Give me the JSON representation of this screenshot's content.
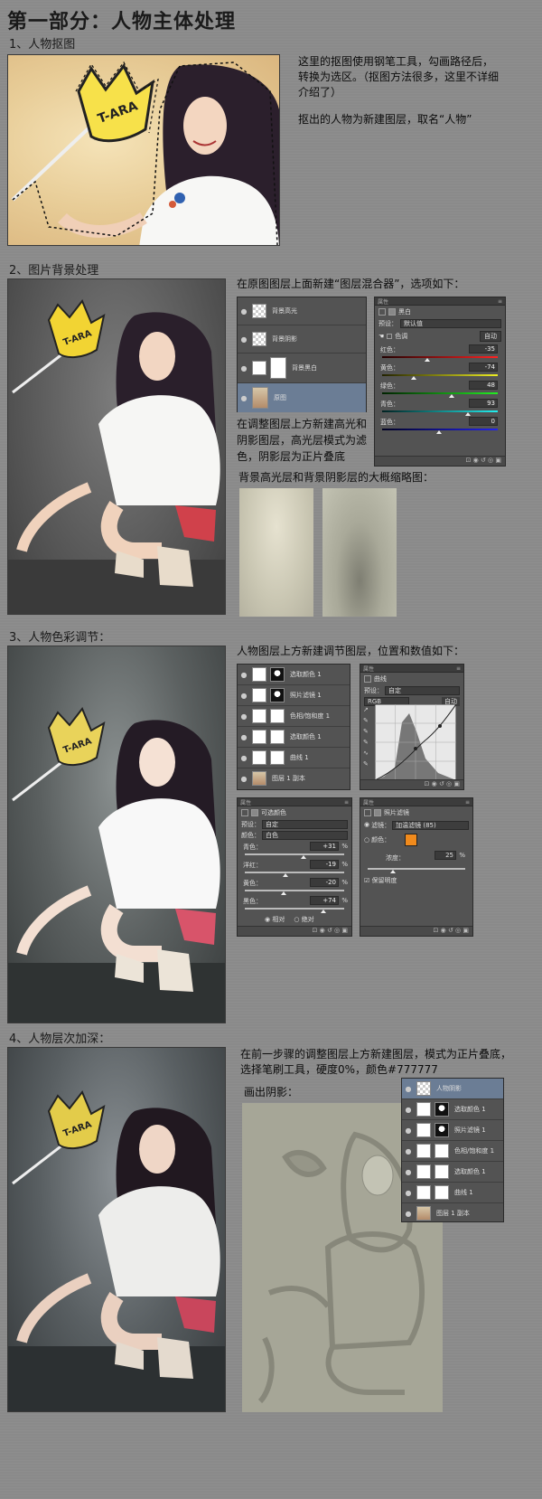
{
  "title": "第一部分：人物主体处理",
  "step1": {
    "heading": "1、人物抠图",
    "text1": "这里的抠图使用钢笔工具，勾画路径后，转换为选区。（抠图方法很多，这里不详细介绍了）",
    "text2": "抠出的人物为新建图层，取名“人物”",
    "sign_text": "T-ARA"
  },
  "step2": {
    "heading": "2、图片背景处理",
    "intro": "在原图图层上面新建“图层混合器”，选项如下：",
    "layers": [
      "背景高光",
      "背景阴影",
      "背景黑白",
      "原图"
    ],
    "adj_title": "黑白",
    "preset_label": "预设：",
    "preset_value": "默认值",
    "tint_label": "色调",
    "auto_label": "自动",
    "sliders": [
      {
        "label": "红色：",
        "value": "-35"
      },
      {
        "label": "黄色：",
        "value": "-74"
      },
      {
        "label": "绿色：",
        "value": "48"
      },
      {
        "label": "青色：",
        "value": "93"
      },
      {
        "label": "蓝色：",
        "value": "0"
      }
    ],
    "note": "在调整图层上方新建高光和阴影图层，高光层模式为滤色，阴影层为正片叠底",
    "thumb_caption": "背景高光层和背景阴影层的大概缩略图：",
    "sign_text": "T-ARA"
  },
  "step3": {
    "heading": "3、人物色彩调节：",
    "intro": "人物图层上方新建调节图层，位置和数值如下：",
    "layers": [
      "选取颜色 1",
      "照片滤镜 1",
      "色相/饱和度 1",
      "选取颜色 1",
      "曲线 1",
      "图层 1 副本"
    ],
    "curves_title": "曲线",
    "curves_preset_label": "预设：",
    "curves_preset_value": "自定",
    "curves_channel": "RGB",
    "curves_auto": "自动",
    "sc_title": "可选颜色",
    "sc_preset_label": "预设：",
    "sc_preset_value": "自定",
    "sc_color_label": "颜色：",
    "sc_color_value": "白色",
    "sc_sliders": [
      {
        "label": "青色：",
        "value": "+31",
        "unit": "%"
      },
      {
        "label": "洋红：",
        "value": "-19",
        "unit": "%"
      },
      {
        "label": "黄色：",
        "value": "-20",
        "unit": "%"
      },
      {
        "label": "黑色：",
        "value": "+74",
        "unit": "%"
      }
    ],
    "sc_radio1": "相对",
    "sc_radio2": "绝对",
    "pf_title": "照片滤镜",
    "pf_filter_label": "滤镜：",
    "pf_filter_value": "加温滤镜 (85)",
    "pf_color_label": "颜色：",
    "pf_density_label": "浓度：",
    "pf_density_value": "25",
    "pf_density_unit": "%",
    "pf_preserve": "保留明度",
    "pf_color": "#f08a1c",
    "sign_text": "T-ARA"
  },
  "step4": {
    "heading": "4、人物层次加深：",
    "intro": "在前一步骤的调整图层上方新建图层，模式为正片叠底，选择笔刷工具，硬度0%，颜色#777777",
    "shadow_label": "画出阴影：",
    "layers": [
      "人物阴影",
      "选取颜色 1",
      "照片滤镜 1",
      "色相/饱和度 1",
      "选取颜色 1",
      "曲线 1",
      "图层 1 副本"
    ],
    "sign_text": "T-ARA"
  },
  "panel_header": "属性"
}
